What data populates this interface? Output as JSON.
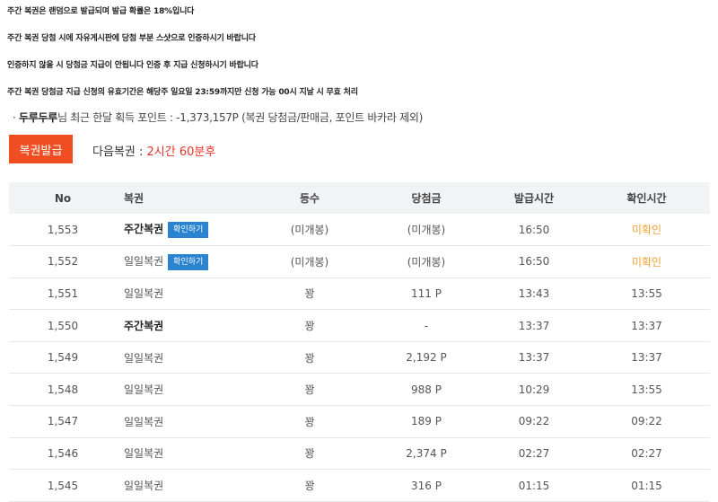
{
  "notices": [
    "주간 복권은 랜덤으로 발급되며 발급 확률은 18%입니다",
    "주간 복권 당첨 시에 자유게시판에 당첨 부분 스샷으로 인증하시기 바랍니다",
    "인증하지 않을 시 당첨금 지급이 안됩니다 인증 후 지급 신청하시기 바랍니다",
    "주간 복권 당첨금 지급 신청의 유효기간은 해당주 일요일 23:59까지만 신청 가능 00시 지날 시 무효 처리"
  ],
  "points": {
    "prefix": "· ",
    "nickname": "두루두루",
    "text": "님 최근 한달 획득 포인트 : -1,373,157P (복권 당첨금/판매금, 포인트 바카라 제외)"
  },
  "issue_button": "복권발급",
  "next": {
    "label": "다음복권 : ",
    "time": "2시간 60분후"
  },
  "table": {
    "headers": [
      "No",
      "복권",
      "등수",
      "당첨금",
      "발급시간",
      "확인시간"
    ],
    "rows": [
      {
        "no": "1,553",
        "ticket": "주간복권",
        "bold": true,
        "button": "확인하기",
        "rank": "(미개봉)",
        "prize": "(미개봉)",
        "issued": "16:50",
        "checked": "미확인",
        "unconfirmed": true
      },
      {
        "no": "1,552",
        "ticket": "일일복권",
        "bold": false,
        "button": "확인하기",
        "rank": "(미개봉)",
        "prize": "(미개봉)",
        "issued": "16:50",
        "checked": "미확인",
        "unconfirmed": true
      },
      {
        "no": "1,551",
        "ticket": "일일복권",
        "bold": false,
        "button": "",
        "rank": "꽝",
        "prize": "111 P",
        "issued": "13:43",
        "checked": "13:55",
        "unconfirmed": false
      },
      {
        "no": "1,550",
        "ticket": "주간복권",
        "bold": true,
        "button": "",
        "rank": "꽝",
        "prize": "-",
        "issued": "13:37",
        "checked": "13:37",
        "unconfirmed": false
      },
      {
        "no": "1,549",
        "ticket": "일일복권",
        "bold": false,
        "button": "",
        "rank": "꽝",
        "prize": "2,192 P",
        "issued": "13:37",
        "checked": "13:37",
        "unconfirmed": false
      },
      {
        "no": "1,548",
        "ticket": "일일복권",
        "bold": false,
        "button": "",
        "rank": "꽝",
        "prize": "988 P",
        "issued": "10:29",
        "checked": "13:55",
        "unconfirmed": false
      },
      {
        "no": "1,547",
        "ticket": "일일복권",
        "bold": false,
        "button": "",
        "rank": "꽝",
        "prize": "189 P",
        "issued": "09:22",
        "checked": "09:22",
        "unconfirmed": false
      },
      {
        "no": "1,546",
        "ticket": "일일복권",
        "bold": false,
        "button": "",
        "rank": "꽝",
        "prize": "2,374 P",
        "issued": "02:27",
        "checked": "02:27",
        "unconfirmed": false
      },
      {
        "no": "1,545",
        "ticket": "일일복권",
        "bold": false,
        "button": "",
        "rank": "꽝",
        "prize": "316 P",
        "issued": "01:15",
        "checked": "01:15",
        "unconfirmed": false
      }
    ]
  }
}
